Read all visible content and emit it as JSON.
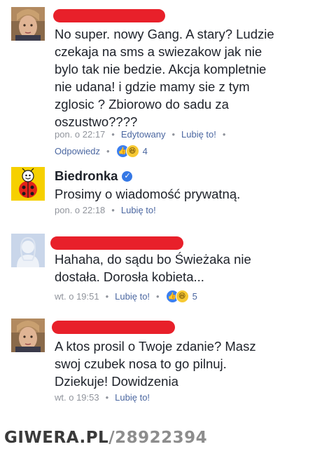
{
  "comments": [
    {
      "author": "",
      "author_redacted": true,
      "avatar": "woman-photo-avatar",
      "text": "No super. nowy Gang. A stary? Ludzie\nczekaja na sms a swiezakow jak nie\nbylo tak nie bedzie. Akcja kompletnie\nnie udana! i gdzie mamy sie z tym\nzglosic ? Zbiorowo do sadu za\noszustwo????",
      "time": "pon. o 22:17",
      "edited": "Edytowany",
      "like": "Lubię to!",
      "reply": "Odpowiedz",
      "reactions": [
        "like",
        "haha"
      ],
      "reaction_count": "4"
    },
    {
      "author": "Biedronka",
      "verified": true,
      "avatar": "ladybug-logo-avatar",
      "text": "Prosimy o wiadomość prywatną.",
      "time": "pon. o 22:18",
      "like": "Lubię to!"
    },
    {
      "author": "",
      "author_redacted": true,
      "avatar": "default-silhouette-avatar",
      "text": "Hahaha, do sądu bo Świeżaka nie\ndostała. Dorosła kobieta...",
      "time": "wt. o 19:51",
      "like": "Lubię to!",
      "reactions": [
        "like",
        "haha"
      ],
      "reaction_count": "5"
    },
    {
      "author": "",
      "author_redacted": true,
      "avatar": "woman-photo-avatar",
      "text": "A ktos prosil o Twoje zdanie? Masz\nswoj czubek nosa to go pilnuj.\nDziekuje! Dowidzenia",
      "time": "wt. o 19:53",
      "like": "Lubię to!"
    }
  ],
  "watermark": {
    "site": "GIWERA.PL",
    "id": "/28922394"
  },
  "colors": {
    "link": "#4b67a1",
    "meta": "#90949c",
    "redaction": "#e8202a",
    "verified": "#3578e5"
  }
}
